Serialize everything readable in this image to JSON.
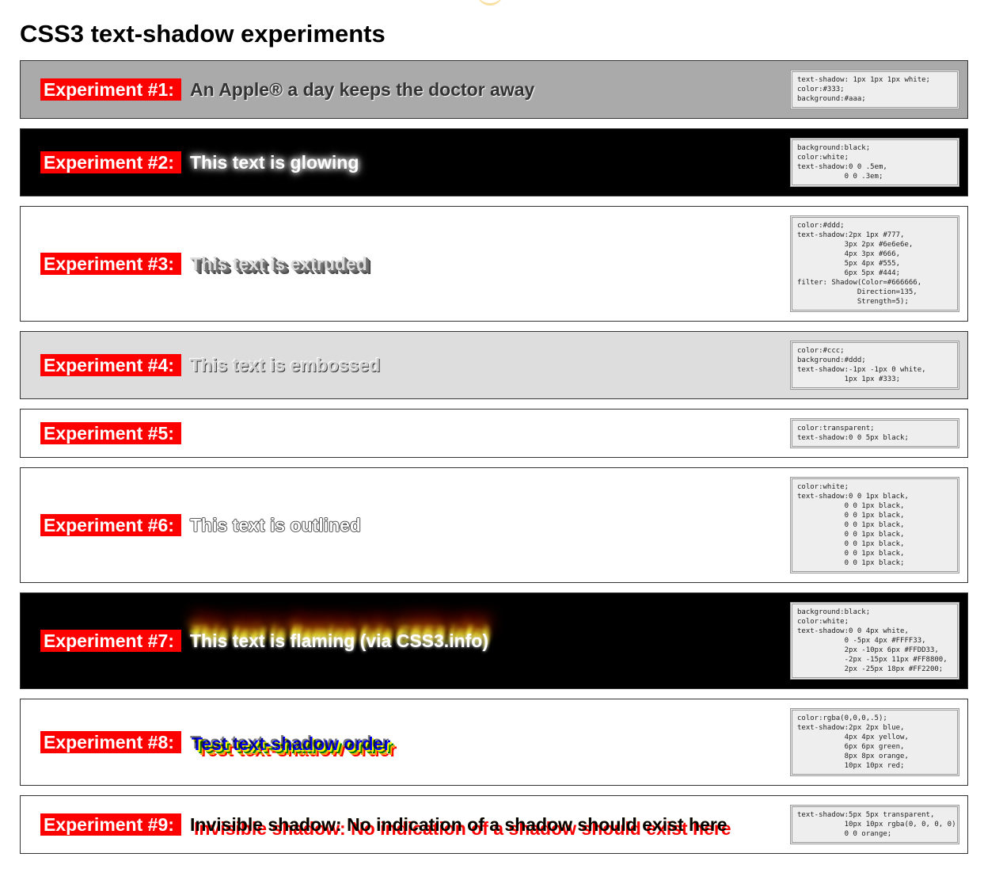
{
  "page": {
    "title": "CSS3 text-shadow experiments"
  },
  "experiments": [
    {
      "label": "Experiment #1:",
      "text": "An Apple® a day keeps the doctor away",
      "code": "text-shadow: 1px 1px 1px white;\ncolor:#333;\nbackground:#aaa;"
    },
    {
      "label": "Experiment #2:",
      "text": "This text is glowing",
      "code": "background:black;\ncolor:white;\ntext-shadow:0 0 .5em,\n           0 0 .3em;"
    },
    {
      "label": "Experiment #3:",
      "text": "This text is extruded",
      "code": "color:#ddd;\ntext-shadow:2px 1px #777,\n           3px 2px #6e6e6e,\n           4px 3px #666,\n           5px 4px #555,\n           6px 5px #444;\nfilter: Shadow(Color=#666666,\n              Direction=135,\n              Strength=5);"
    },
    {
      "label": "Experiment #4:",
      "text": "This text is embossed",
      "code": "color:#ccc;\nbackground:#ddd;\ntext-shadow:-1px -1px 0 white,\n           1px 1px #333;"
    },
    {
      "label": "Experiment #5:",
      "text": "",
      "code": "color:transparent;\ntext-shadow:0 0 5px black;"
    },
    {
      "label": "Experiment #6:",
      "text": "This text is outlined",
      "code": "color:white;\ntext-shadow:0 0 1px black,\n           0 0 1px black,\n           0 0 1px black,\n           0 0 1px black,\n           0 0 1px black,\n           0 0 1px black,\n           0 0 1px black,\n           0 0 1px black;"
    },
    {
      "label": "Experiment #7:",
      "text": "This text is flaming (via CSS3.info)",
      "code": "background:black;\ncolor:white;\ntext-shadow:0 0 4px white,\n           0 -5px 4px #FFFF33,\n           2px -10px 6px #FFDD33,\n           -2px -15px 11px #FF8800,\n           2px -25px 18px #FF2200;"
    },
    {
      "label": "Experiment #8:",
      "text": "Test text-shadow order",
      "code": "color:rgba(0,0,0,.5);\ntext-shadow:2px 2px blue,\n           4px 4px yellow,\n           6px 6px green,\n           8px 8px orange,\n           10px 10px red;"
    },
    {
      "label": "Experiment #9:",
      "text": "Invisible shadow: No indication of a shadow should exist here",
      "code": "text-shadow:5px 5px transparent,\n           10px 10px rgba(0, 0, 0, 0),\n           0 0 orange;"
    }
  ],
  "colors": {
    "label_background": "#ff0000",
    "label_text": "#ffffff"
  }
}
